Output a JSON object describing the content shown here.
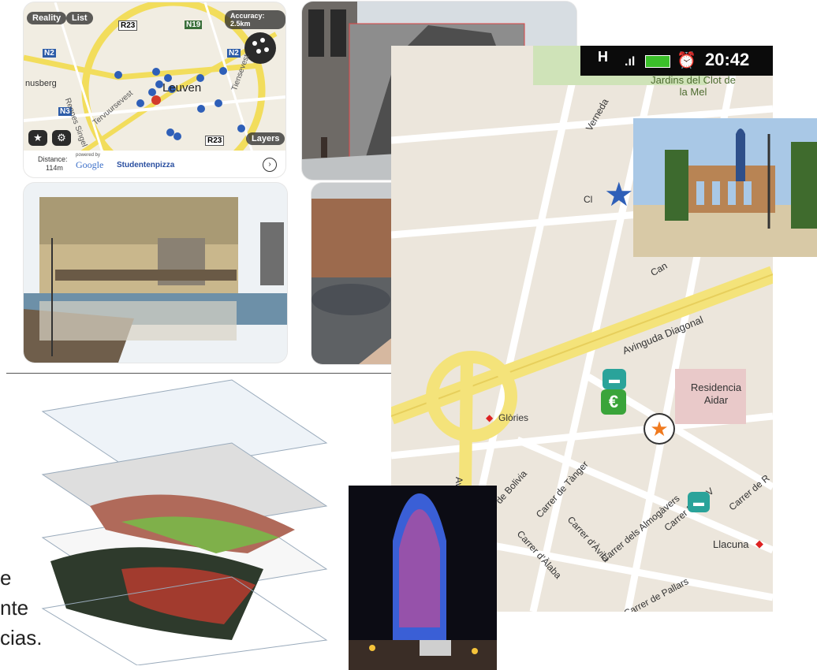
{
  "ar_app": {
    "tabs": [
      "Reality",
      "List"
    ],
    "accuracy": "Accuracy: 2.5km",
    "city": "Leuven",
    "roads": [
      "R23",
      "N19",
      "N2",
      "N3",
      "N2",
      "R23"
    ],
    "places": [
      "nusberg",
      "Rennes Singel",
      "Tervuursevest",
      "Tiensevest"
    ],
    "layers_button": "Layers",
    "distance_label": "Distance:",
    "distance_value": "114m",
    "powered_by": "powered by",
    "google": "Google",
    "poi_name": "Studentenpizza"
  },
  "phone_map": {
    "status_time": "20:42",
    "network": "H",
    "labels": {
      "park": "Jardins del Clot de la Mel",
      "street_verneda": "Verneda",
      "avenue": "Avinguda Diagonal",
      "residence": "Residencia Aidar",
      "metro_glories": "Glòries",
      "bolivia": "Carrer de Bolivia",
      "tanger": "Carrer de Tànger",
      "avila": "Carrer d'Àvila",
      "alaba": "Carrer d'Àlaba",
      "almogavers": "Carrer dels Almogàvers",
      "pere_iv": "Carrer Pere IV",
      "pallars": "Carrer de Pallars",
      "metro_llacuna": "Llacuna",
      "clot": "Cl",
      "ave_partial": "Avi",
      "carrer_partial": "Carrer de R",
      "can": "Can"
    }
  },
  "caption": {
    "line1": "e",
    "line2": "nte",
    "line3": "cias."
  },
  "colors": {
    "map_bg": "#ece6dc",
    "yellow_road": "#f4e37a",
    "blue_pin": "#2e5fb8",
    "red_pin": "#d23b2b",
    "teal_icon": "#2aa39a",
    "green_icon": "#3aa43a",
    "orange_star": "#f07a1f"
  }
}
